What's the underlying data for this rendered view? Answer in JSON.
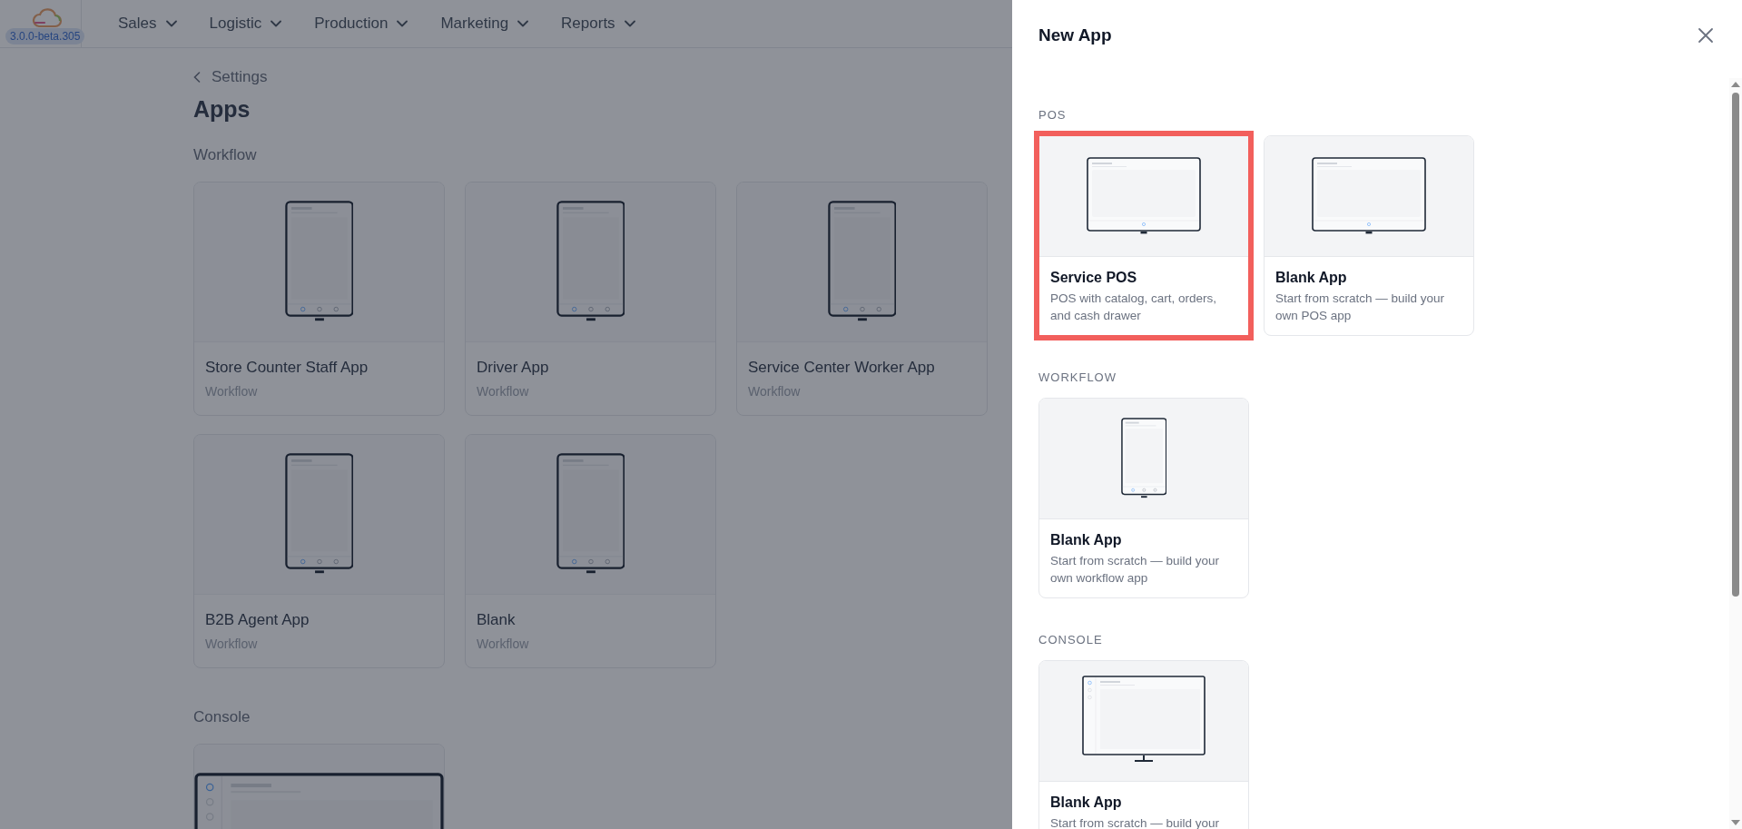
{
  "nav": {
    "version": "3.0.0-beta.305",
    "menus": [
      {
        "label": "Sales"
      },
      {
        "label": "Logistic"
      },
      {
        "label": "Production"
      },
      {
        "label": "Marketing"
      },
      {
        "label": "Reports"
      }
    ]
  },
  "page": {
    "back_link": "Settings",
    "title": "Apps",
    "sections": [
      {
        "heading": "Workflow",
        "apps": [
          {
            "name": "Store Counter Staff App",
            "category": "Workflow",
            "kind": "phone"
          },
          {
            "name": "Driver App",
            "category": "Workflow",
            "kind": "phone"
          },
          {
            "name": "Service Center Worker App",
            "category": "Workflow",
            "kind": "phone"
          },
          {
            "name": "B2B Agent App",
            "category": "Workflow",
            "kind": "phone"
          },
          {
            "name": "Blank",
            "category": "Workflow",
            "kind": "phone"
          }
        ]
      },
      {
        "heading": "Console",
        "apps": [
          {
            "kind": "monitor"
          }
        ]
      }
    ]
  },
  "dialog": {
    "title": "New App",
    "sections": [
      {
        "heading": "POS",
        "templates": [
          {
            "name": "Service POS",
            "description": "POS with catalog, cart, orders, and cash drawer",
            "kind": "tablet",
            "selected": true
          },
          {
            "name": "Blank App",
            "description": "Start from scratch — build your own POS app",
            "kind": "tablet",
            "selected": false
          }
        ]
      },
      {
        "heading": "WORKFLOW",
        "templates": [
          {
            "name": "Blank App",
            "description": "Start from scratch — build your own workflow app",
            "kind": "phone",
            "selected": false
          }
        ]
      },
      {
        "heading": "CONSOLE",
        "templates": [
          {
            "name": "Blank App",
            "description": "Start from scratch — build your",
            "kind": "monitor",
            "selected": false
          }
        ]
      }
    ]
  }
}
